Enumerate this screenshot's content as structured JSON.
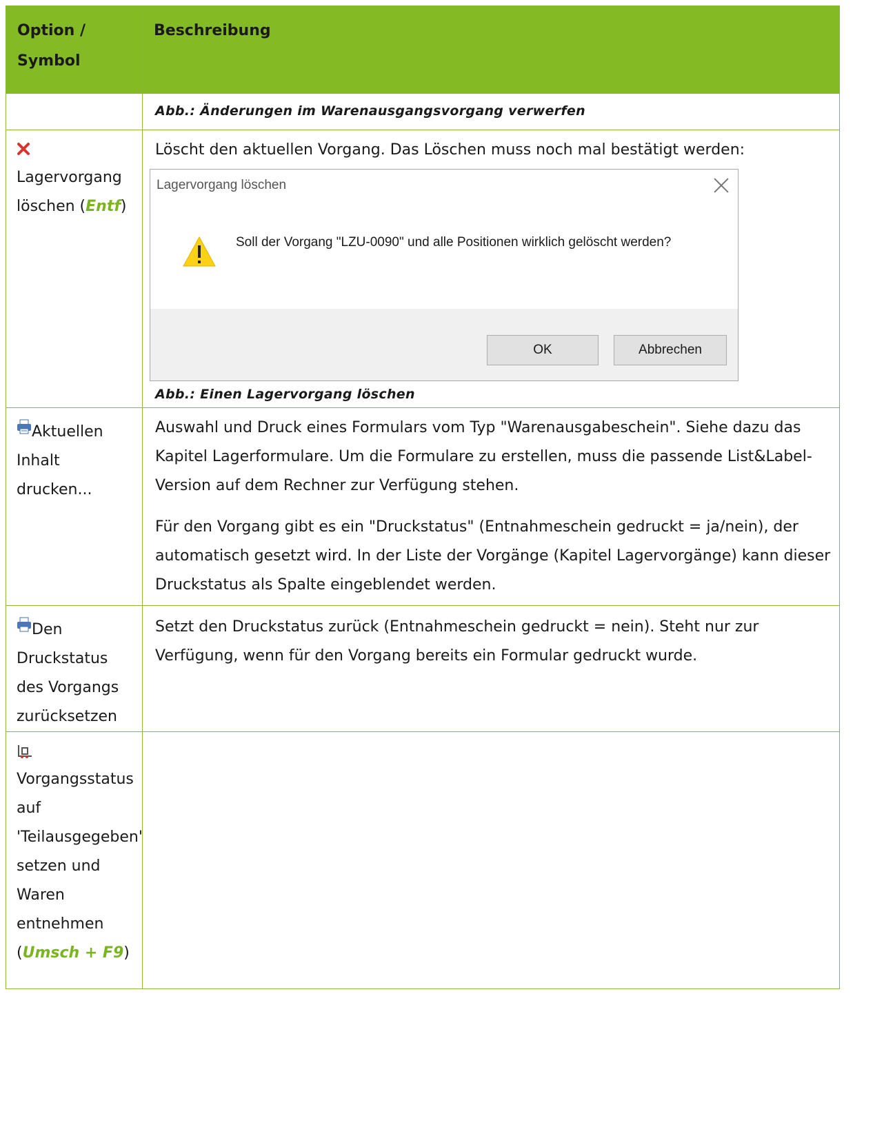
{
  "header": {
    "col1": "Option / Symbol",
    "col2": "Beschreibung"
  },
  "rows": {
    "discard": {
      "caption": "Abb.: Änderungen im Warenausgangsvorgang verwerfen"
    },
    "delete": {
      "icon": "red-x-delete-icon",
      "label_pre": "Lagervorgang löschen (",
      "hotkey": "Entf",
      "label_post": ")",
      "description": "Löscht den aktuellen Vorgang. Das Löschen muss noch mal bestätigt werden:",
      "dialog": {
        "title": "Lagervorgang löschen",
        "message": "Soll der Vorgang \"LZU-0090\" und alle Positionen wirklich gelöscht werden?",
        "ok": "OK",
        "cancel": "Abbrechen",
        "icon": "warning-triangle-icon"
      },
      "caption": "Abb.: Einen Lagervorgang löschen"
    },
    "print": {
      "icon": "printer-icon",
      "label": "Aktuellen Inhalt drucken...",
      "para1": "Auswahl und Druck eines Formulars vom Typ \"Warenausgabeschein\". Siehe dazu das Kapitel Lagerformulare. Um die Formulare zu erstellen, muss die passende List&Label-Version auf dem Rechner zur Verfügung stehen.",
      "para2": "Für den Vorgang gibt es ein \"Druckstatus\" (Entnahmeschein gedruckt = ja/nein), der automatisch gesetzt wird. In der Liste der Vorgänge (Kapitel Lagervorgänge) kann dieser Druckstatus als Spalte eingeblendet werden."
    },
    "reset": {
      "icon": "printer-reset-icon",
      "label": "Den Druckstatus des Vorgangs zurücksetzen",
      "description": "Setzt den Druckstatus zurück (Entnahmeschein gedruckt = nein). Steht nur zur Verfügung, wenn für den Vorgang bereits ein Formular gedruckt wurde."
    },
    "partial": {
      "icon": "forklift-status-icon",
      "label_pre": "Vorgangsstatus auf 'Teilausgegeben' setzen und Waren entnehmen (",
      "hotkey": "Umsch + F9",
      "label_post": ")",
      "description": ""
    }
  },
  "colors": {
    "header_bg": "#84bb24",
    "border": "#8ab833",
    "hotkey": "#7ab521"
  }
}
